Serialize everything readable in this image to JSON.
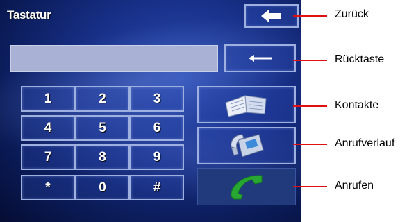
{
  "screen": {
    "title": "Tastatur"
  },
  "keypad": {
    "keys": [
      "1",
      "2",
      "3",
      "4",
      "5",
      "6",
      "7",
      "8",
      "9",
      "*",
      "0",
      "#"
    ]
  },
  "callouts": {
    "back": "Zurück",
    "backspace": "Rücktaste",
    "contacts": "Kontakte",
    "call_history": "Anrufverlauf",
    "call": "Anrufen"
  },
  "colors": {
    "background_dark": "#0a1a55",
    "background_light": "#2a4bb3",
    "button_border": "#9db0e0",
    "display_field": "#a9b2d4",
    "call_green": "#28a832",
    "leader_line": "#e01010"
  }
}
